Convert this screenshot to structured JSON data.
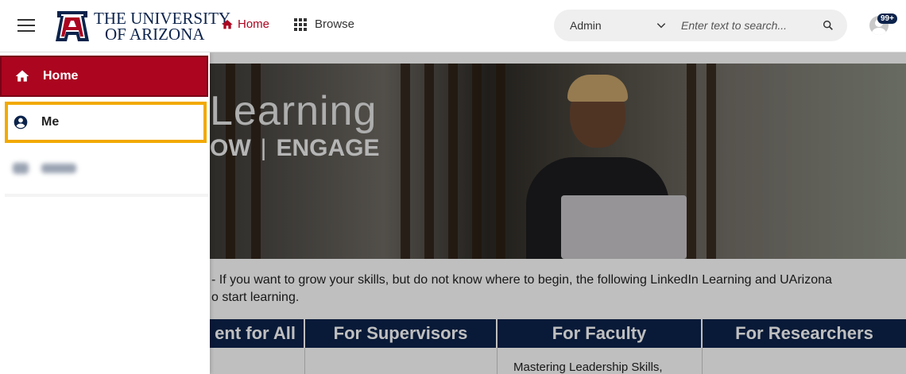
{
  "header": {
    "logo": {
      "line1": "THE UNIVERSITY",
      "line2": "OF ARIZONA"
    },
    "nav": {
      "home_label": "Home",
      "browse_label": "Browse"
    },
    "search": {
      "scope_value": "Admin",
      "placeholder": "Enter text to search..."
    },
    "notifications_badge": "99+"
  },
  "drawer": {
    "items": [
      {
        "label": "Home",
        "icon": "home-icon",
        "state": "selected"
      },
      {
        "label": "Me",
        "icon": "account-circle-icon",
        "state": "focused"
      }
    ]
  },
  "main": {
    "hero": {
      "title_partial": "Learning",
      "sub_left": "OW",
      "sub_right": "ENGAGE"
    },
    "intro_line1": "- If you want to grow your skills, but do not know where to begin, the following LinkedIn Learning and UArizona",
    "intro_line2": "o start learning.",
    "tabs": [
      "ent for All",
      "For Supervisors",
      "For Faculty",
      "For Researchers"
    ],
    "cells": [
      "",
      "",
      "Mastering Leadership Skills,",
      ""
    ]
  },
  "colors": {
    "brand_red": "#ab0520",
    "brand_navy": "#0c234b",
    "focus_ring": "#f2a900"
  }
}
